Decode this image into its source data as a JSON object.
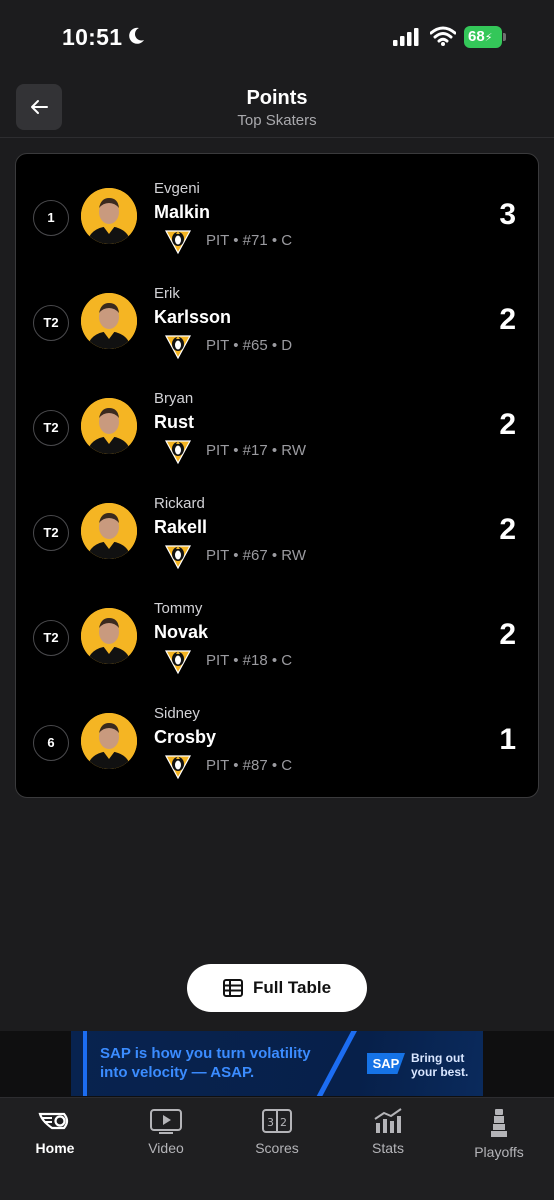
{
  "status_bar": {
    "time": "10:51",
    "battery": "68"
  },
  "header": {
    "title": "Points",
    "subtitle": "Top Skaters"
  },
  "players": [
    {
      "rank": "1",
      "first_name": "Evgeni",
      "last_name": "Malkin",
      "meta": "PIT • #71 • C",
      "points": "3"
    },
    {
      "rank": "T2",
      "first_name": "Erik",
      "last_name": "Karlsson",
      "meta": "PIT • #65 • D",
      "points": "2"
    },
    {
      "rank": "T2",
      "first_name": "Bryan",
      "last_name": "Rust",
      "meta": "PIT • #17 • RW",
      "points": "2"
    },
    {
      "rank": "T2",
      "first_name": "Rickard",
      "last_name": "Rakell",
      "meta": "PIT • #67 • RW",
      "points": "2"
    },
    {
      "rank": "T2",
      "first_name": "Tommy",
      "last_name": "Novak",
      "meta": "PIT • #18 • C",
      "points": "2"
    },
    {
      "rank": "6",
      "first_name": "Sidney",
      "last_name": "Crosby",
      "meta": "PIT • #87 • C",
      "points": "1"
    }
  ],
  "full_table_label": "Full Table",
  "ad": {
    "text": "SAP is how you turn volatility into velocity — ASAP.",
    "logo": "SAP",
    "tagline": "Bring out your best."
  },
  "tabs": [
    {
      "label": "Home",
      "icon": "flyers-logo-icon",
      "active": true
    },
    {
      "label": "Video",
      "icon": "video-play-icon",
      "active": false
    },
    {
      "label": "Scores",
      "icon": "scoreboard-icon",
      "active": false
    },
    {
      "label": "Stats",
      "icon": "stats-chart-icon",
      "active": false
    },
    {
      "label": "Playoffs",
      "icon": "stanley-cup-icon",
      "active": false
    }
  ],
  "colors": {
    "background": "#1c1c1e",
    "card": "#000000",
    "avatar_gold": "#f5b523",
    "battery_green": "#34c759",
    "ad_blue": "#3b8cff"
  }
}
